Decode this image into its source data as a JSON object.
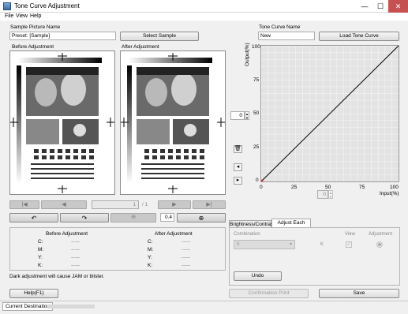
{
  "window": {
    "title": "Tone Curve Adjustment",
    "min": "—",
    "max": "☐",
    "close": "✕"
  },
  "menu": [
    "File",
    "View",
    "Help"
  ],
  "sample": {
    "label": "Sample Picture Name",
    "value": "Preset: [Sample]",
    "button": "Select Sample"
  },
  "tone_curve": {
    "label": "Tone Curve Name",
    "value": "New",
    "button": "Load Tone Curve"
  },
  "before_label": "Before Adjustment",
  "after_label": "After Adjustment",
  "pager": {
    "current": "1",
    "total": "/ 1"
  },
  "zoom_value": "0.4",
  "table": {
    "before_header": "Before Adjustment",
    "after_header": "After Adjustment",
    "rows": [
      {
        "label": "C:",
        "before": "-----",
        "after": "-----"
      },
      {
        "label": "M:",
        "before": "-----",
        "after": "-----"
      },
      {
        "label": "Y:",
        "before": "-----",
        "after": "-----"
      },
      {
        "label": "K:",
        "before": "-----",
        "after": "-----"
      }
    ]
  },
  "warning": "Dark adjustment will cause JAM or blister.",
  "graph": {
    "ylabel": "Output(%)",
    "xlabel": "Input(%)",
    "ticks": [
      "0",
      "25",
      "50",
      "75",
      "100"
    ],
    "output_value": "0",
    "input_value": "0"
  },
  "tabs": {
    "brightness": "Brightness/Contrast",
    "adjust": "Adjust Each Color"
  },
  "color_panel": {
    "combination": "Combination",
    "view": "View",
    "adjustment": "Adjustment",
    "k_label": "K",
    "undo": "Undo"
  },
  "buttons": {
    "help": "Help(F1)",
    "confirmation": "Confirmation Print",
    "save": "Save"
  },
  "status": {
    "label": "Current Destination"
  },
  "colors": {
    "accent": "#3a6ea8",
    "grid": "#ffffff",
    "curve": "#000000"
  }
}
